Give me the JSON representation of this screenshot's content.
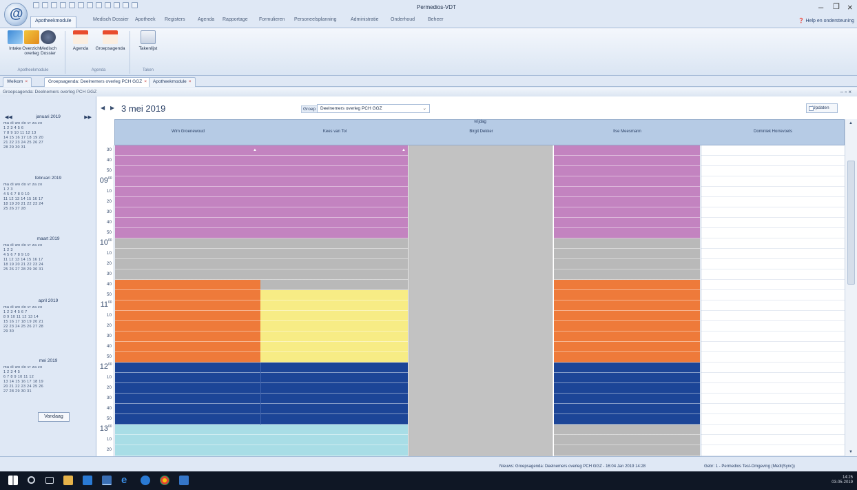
{
  "window": {
    "title": "Permedios-VDT"
  },
  "ribbon_tabs": [
    "Apotheekmodule",
    "Medisch Dossier",
    "Apotheek",
    "Registers",
    "Agenda",
    "Rapportage",
    "Formulieren",
    "Personeelsplanning",
    "Administratie",
    "Onderhoud",
    "Beheer"
  ],
  "help_label": "Help en ondersteuning",
  "ribbon_buttons": [
    {
      "label": "Intake",
      "group": "Apotheekmodule"
    },
    {
      "label": "Overzicht overleg",
      "group": "Apotheekmodule"
    },
    {
      "label": "Medisch Dossier",
      "group": "Apotheekmodule"
    },
    {
      "label": "Agenda",
      "group": "Agenda"
    },
    {
      "label": "Groepsagenda",
      "group": "Agenda"
    },
    {
      "label": "Takenlijst",
      "group": "Taken"
    }
  ],
  "ribbon_groups": [
    "Apotheekmodule",
    "Agenda",
    "Taken"
  ],
  "doc_tabs": [
    "Welkom",
    "Groepsagenda: Deelnemers overleg PCH GGZ",
    "Apotheekmodule"
  ],
  "sub_header": "Groepsagenda: Deelnemers overleg PCH GGZ",
  "calendar": {
    "date_label": "3 mei 2019",
    "group_label": "Groep",
    "group_value": "Deelnemers overleg PCH GGZ",
    "update_label": "Updaten",
    "day_header": "vrijdag",
    "columns": [
      "Wim Groenewoud",
      "Kees van Tol",
      "Birgit Dekker",
      "Ilse Meesmann",
      "Dominiek Horrevoets"
    ],
    "today_button": "Vandaag"
  },
  "mini_calendars": [
    {
      "month": "januari 2019",
      "weekdays": "ma di wo do vr za zo",
      "weeks": [
        "1 2 3 4 5 6",
        "7 8 9 10 11 12 13",
        "14 15 16 17 18 19 20",
        "21 22 23 24 25 26 27",
        "28 29 30 31"
      ]
    },
    {
      "month": "februari 2019",
      "weekdays": "ma di wo do vr za zo",
      "weeks": [
        "1 2 3",
        "4 5 6 7 8 9 10",
        "11 12 13 14 15 16 17",
        "18 19 20 21 22 23 24",
        "25 26 27 28"
      ]
    },
    {
      "month": "maart 2019",
      "weekdays": "ma di wo do vr za zo",
      "weeks": [
        "1 2 3",
        "4 5 6 7 8 9 10",
        "11 12 13 14 15 16 17",
        "18 19 20 21 22 23 24",
        "25 26 27 28 29 30 31"
      ]
    },
    {
      "month": "april 2019",
      "weekdays": "ma di wo do vr za zo",
      "weeks": [
        "1 2 3 4 5 6 7",
        "8 9 10 11 12 13 14",
        "15 16 17 18 19 20 21",
        "22 23 24 25 26 27 28",
        "29 30"
      ]
    },
    {
      "month": "mei 2019",
      "weekdays": "ma di wo do vr za zo",
      "weeks": [
        "1 2 3 4 5",
        "6 7 8 9 10 11 12",
        "13 14 15 16 17 18 19",
        "20 21 22 23 24 25 26",
        "27 28 29 30 31"
      ]
    }
  ],
  "time_axis": {
    "hours": [
      "09",
      "10",
      "11",
      "12",
      "13"
    ],
    "minutes": [
      "10",
      "20",
      "30",
      "40",
      "50"
    ],
    "pre_minutes": [
      "30",
      "40",
      "50"
    ],
    "hour_suffix": "00"
  },
  "status": {
    "left": "Nieuws: Groepsagenda: Deelnemers overleg PCH GGZ - 16:04 Jan 2019 14:28",
    "right": "Gebr: 1 - Permedios Test-Omgeving (Medi(Sync))",
    "time": "14:25",
    "date": "03-05-2019"
  },
  "colors": {
    "pink": "#c383c0",
    "gray": "#b9b9b9",
    "orange": "#ee7a3a",
    "yellow": "#f7ec85",
    "navy": "#1c4597",
    "cyan": "#a8dde6",
    "header_blue": "#b6cbe5"
  }
}
